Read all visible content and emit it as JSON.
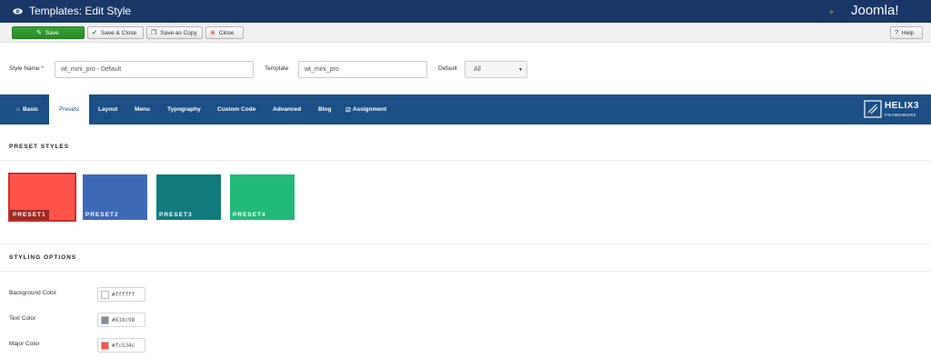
{
  "header": {
    "title": "Templates: Edit Style",
    "logo_text": "Joomla!"
  },
  "toolbar": {
    "save": "Save",
    "save_close": "Save & Close",
    "save_copy": "Save as Copy",
    "close": "Close",
    "help": "Help"
  },
  "style_form": {
    "style_name_label": "Style Name *",
    "style_name_value": "wt_mini_pro - Default",
    "template_label": "Template",
    "template_value": "wt_mini_pro",
    "default_label": "Default",
    "default_value": "All"
  },
  "nav": {
    "tabs": [
      {
        "label": "Basic",
        "icon": "home-icon"
      },
      {
        "label": "Presets"
      },
      {
        "label": "Layout"
      },
      {
        "label": "Menu"
      },
      {
        "label": "Typography"
      },
      {
        "label": "Custom Code"
      },
      {
        "label": "Advanced"
      },
      {
        "label": "Blog"
      },
      {
        "label": "Assignment",
        "icon": "check-square-icon"
      }
    ],
    "active_tab": "Presets",
    "brand": "HELIX3",
    "brand_sub": "FRAMEWORK"
  },
  "presets": {
    "section_title": "PRESET STYLES",
    "items": [
      {
        "label": "PRESET1",
        "color": "#ff5349",
        "selected": true
      },
      {
        "label": "PRESET2",
        "color": "#3d6ab7",
        "selected": false
      },
      {
        "label": "PRESET3",
        "color": "#127b7c",
        "selected": false
      },
      {
        "label": "PRESET4",
        "color": "#22b979",
        "selected": false
      }
    ]
  },
  "styling": {
    "section_title": "STYLING OPTIONS",
    "options": [
      {
        "label": "Background Color",
        "value": "#ffffff"
      },
      {
        "label": "Text Color",
        "value": "#818c98"
      },
      {
        "label": "Major Color",
        "value": "#fc534c"
      }
    ]
  }
}
